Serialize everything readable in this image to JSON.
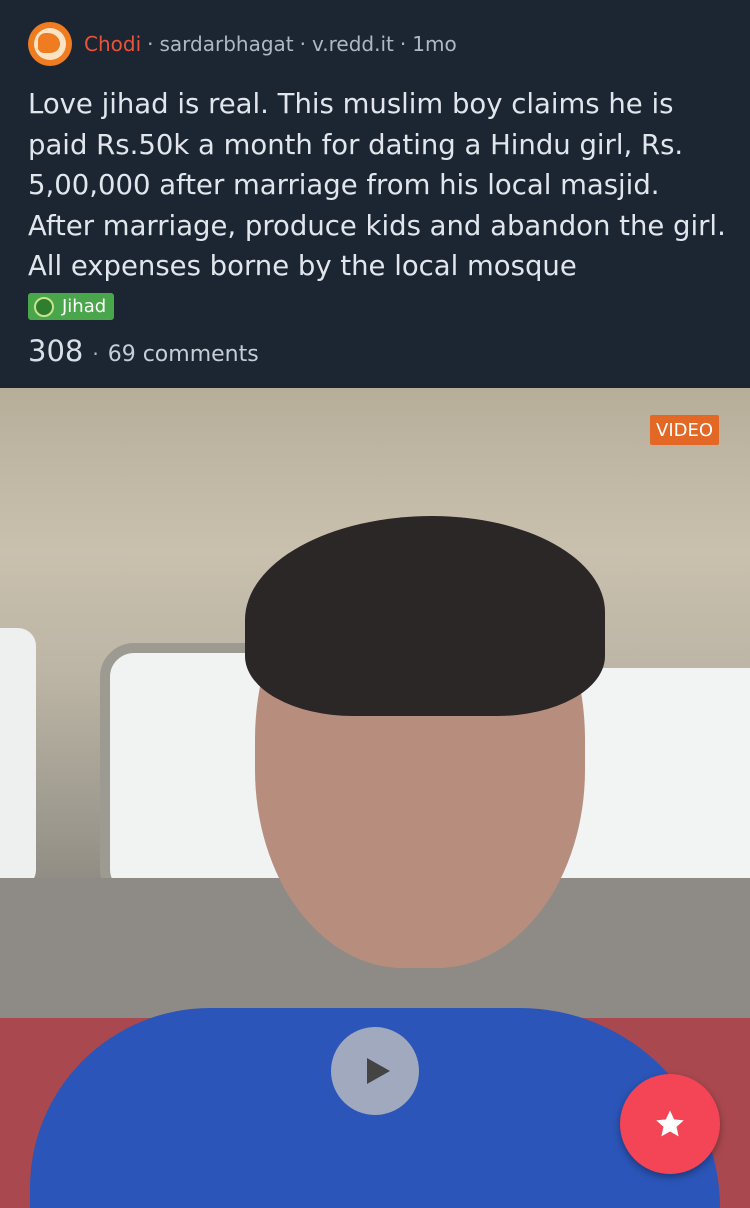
{
  "post": {
    "subreddit": "Chodi",
    "author": "sardarbhagat",
    "domain": "v.redd.it",
    "age": "1mo",
    "separator": "·",
    "title": "Love jihad is real. This muslim boy claims he is paid Rs.50k a month for dating a Hindu girl, Rs. 5,00,000 after marriage from his local masjid. After marriage, produce kids and abandon the girl. All expenses borne by the local mosque",
    "flair": "Jihad",
    "score": "308",
    "comments": "69 comments"
  },
  "media": {
    "badge": "VIDEO"
  },
  "icons": {
    "subreddit": "subreddit-avatar-icon",
    "flair": "flair-emblem-icon",
    "play": "play-icon",
    "fab": "star-icon"
  },
  "colors": {
    "background": "#1c2633",
    "subreddit": "#e8533a",
    "flair": "#4aa64a",
    "badge": "#e36725",
    "fab": "#f44557"
  }
}
